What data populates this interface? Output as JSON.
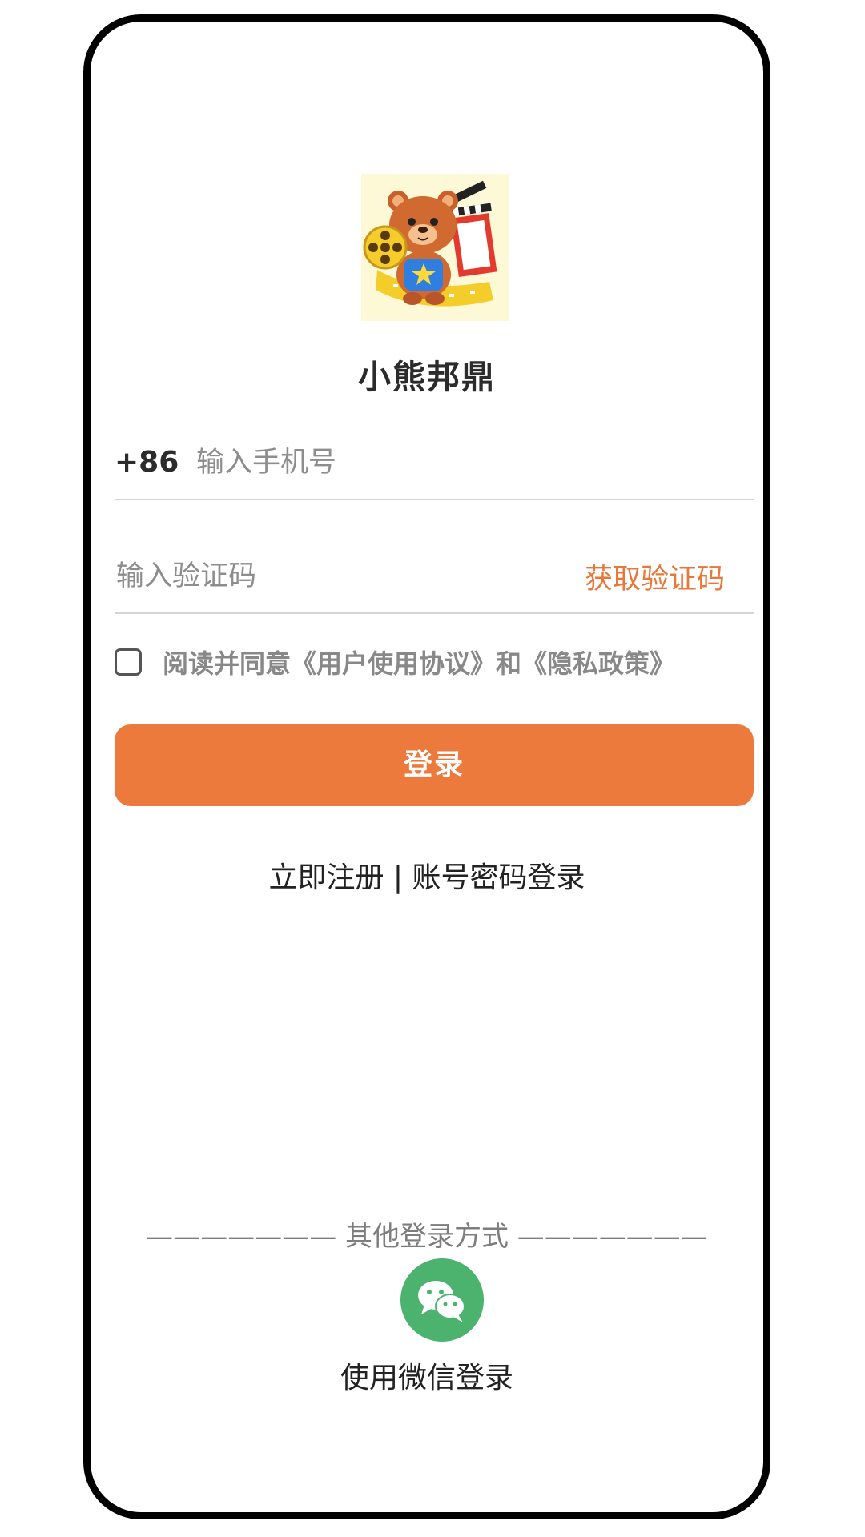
{
  "app": {
    "name": "小熊邦鼎",
    "logo_icon": "bear-film-logo-icon"
  },
  "phone": {
    "country_code": "+86",
    "placeholder": "输入手机号",
    "value": ""
  },
  "code": {
    "placeholder": "输入验证码",
    "value": "",
    "get_code_label": "获取验证码"
  },
  "agreement": {
    "checked": false,
    "text": "阅读并同意《用户使用协议》和《隐私政策》"
  },
  "login_button": {
    "label": "登录",
    "color": "#ec7a3c"
  },
  "links": {
    "register": "立即注册",
    "separator": "|",
    "password_login": "账号密码登录"
  },
  "other_login": {
    "divider_text": "——————— 其他登录方式 ———————",
    "wechat_icon": "wechat-icon",
    "wechat_color": "#4bb36d",
    "wechat_label": "使用微信登录"
  },
  "colors": {
    "accent": "#ec7a3c",
    "placeholder": "#8d8d8d",
    "divider": "#d5d5d5"
  }
}
